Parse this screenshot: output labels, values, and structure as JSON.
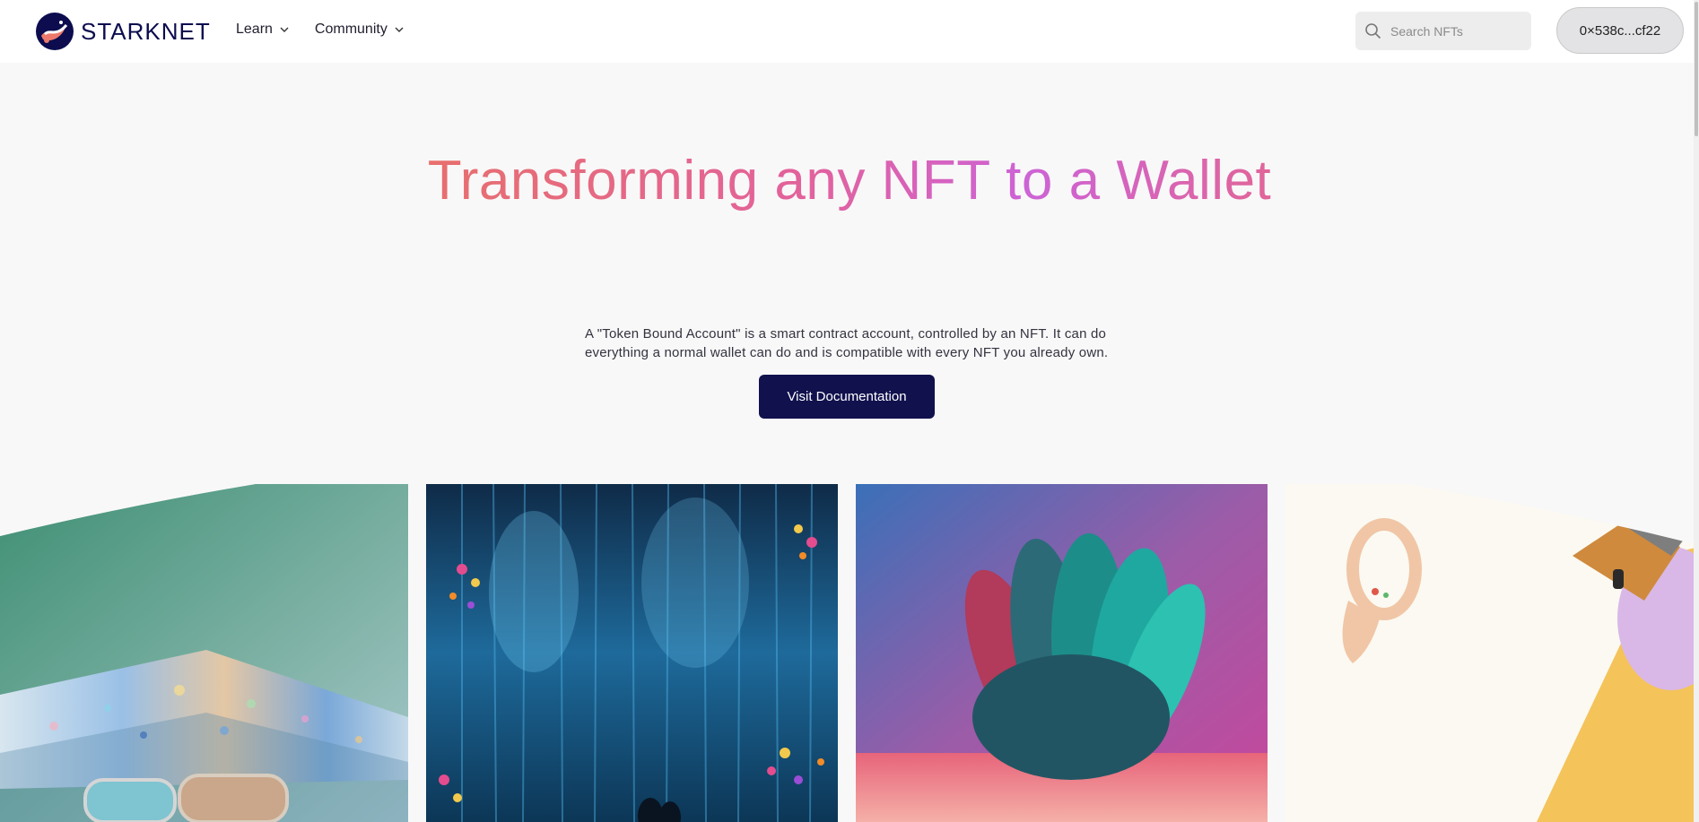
{
  "brand": {
    "name": "STARKNET"
  },
  "nav": {
    "items": [
      {
        "label": "Learn"
      },
      {
        "label": "Community"
      }
    ]
  },
  "search": {
    "placeholder": "Search NFTs",
    "value": ""
  },
  "wallet": {
    "address": "0×538c...cf22"
  },
  "hero": {
    "title": "Transforming any NFT to a Wallet",
    "description": "A \"Token Bound Account\" is a smart contract account, controlled by an NFT. It can do everything a normal wallet can do and is compatible with every NFT you already own.",
    "cta_label": "Visit Documentation"
  },
  "colors": {
    "brand_navy": "#0c0c4f",
    "button": "#11114e",
    "title_gradient_start": "#e8706a",
    "title_gradient_mid": "#cd63d6"
  },
  "gallery": {
    "items": [
      {
        "name": "iridescent-hat-sunglasses-image"
      },
      {
        "name": "digital-waterfall-art-image"
      },
      {
        "name": "teal-feather-sculpture-image"
      },
      {
        "name": "vr-headset-controller-image"
      }
    ]
  }
}
